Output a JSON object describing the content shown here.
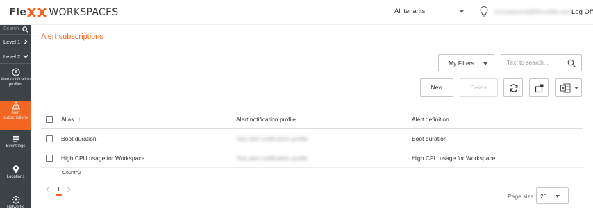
{
  "brand": {
    "prefix": "Fle",
    "suffix": "WORKSPACES",
    "accent": "#f26522"
  },
  "header": {
    "tenant": "All tenants",
    "user_email": "mrosaeound@flexxible.com",
    "logoff": "Log Off"
  },
  "sidebar": {
    "search_label": "Search",
    "levels": [
      {
        "label": "Level 1",
        "icon": "chevron-right-icon"
      },
      {
        "label": "Level 2",
        "icon": "chevron-down-icon"
      }
    ],
    "items": [
      {
        "label": "Alert notification profiles",
        "icon": "alert-circle-icon",
        "active": false
      },
      {
        "label": "Alert subscriptions",
        "icon": "warning-triangle-icon",
        "active": true
      },
      {
        "label": "Event logs",
        "icon": "list-icon",
        "active": false
      },
      {
        "label": "Locations",
        "icon": "map-pin-icon",
        "active": false
      },
      {
        "label": "Networks",
        "icon": "network-icon",
        "active": false
      }
    ]
  },
  "main": {
    "title": "Alert subscriptions",
    "filters_label": "My Filters",
    "search_placeholder": "Text to search...",
    "new_label": "New",
    "delete_label": "Delete"
  },
  "table": {
    "columns": [
      "Alias",
      "Alert notification profile",
      "Alert definition"
    ],
    "sort_indicator": "↑",
    "rows": [
      {
        "alias": "Boot duration",
        "profile": "Test alert notification profile",
        "definition": "Boot duration"
      },
      {
        "alias": "High CPU usage for Workspace",
        "profile": "Test alert notification profile",
        "definition": "High CPU usage for Workspace"
      }
    ],
    "count": "Count=2"
  },
  "pagination": {
    "current_page": "1",
    "page_size_label": "Page size",
    "page_size": "20"
  }
}
